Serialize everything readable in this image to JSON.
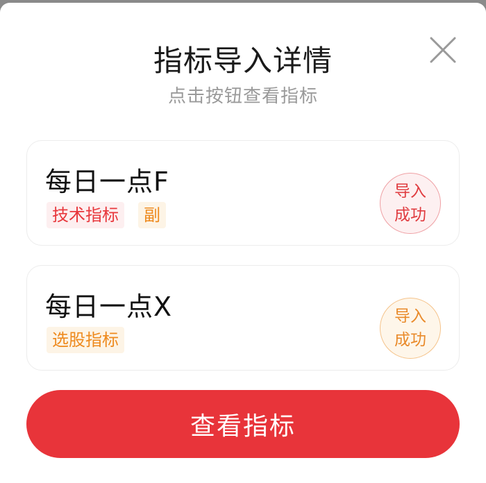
{
  "dialog": {
    "title": "指标导入详情",
    "subtitle": "点击按钮查看指标",
    "close_icon": "close-icon"
  },
  "indicators": [
    {
      "name": "每日一点F",
      "tags": [
        {
          "label": "技术指标",
          "color": "#e8383d"
        },
        {
          "label": "副",
          "color": "#ee8a1e"
        }
      ],
      "status_line1": "导入",
      "status_line2": "成功",
      "status_color": "#e03c40"
    },
    {
      "name": "每日一点X",
      "tags": [
        {
          "label": "选股指标",
          "color": "#ee8a1e"
        }
      ],
      "status_line1": "导入",
      "status_line2": "成功",
      "status_color": "#e98a2a"
    }
  ],
  "footer": {
    "view_button_label": "查看指标",
    "button_color": "#e8343a"
  }
}
